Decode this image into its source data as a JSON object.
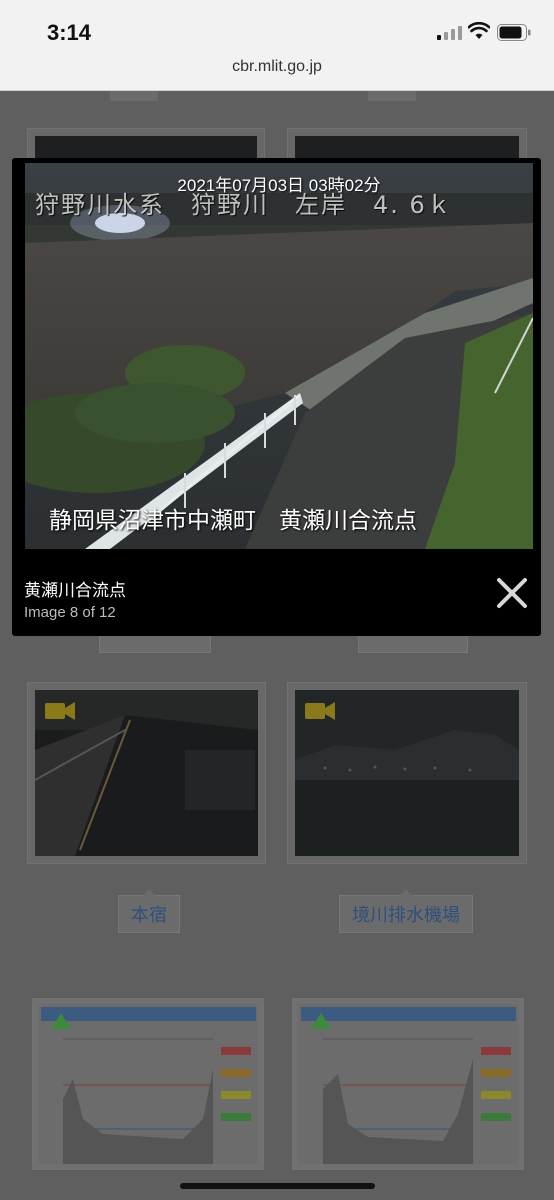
{
  "status_bar": {
    "time": "3:14",
    "url": "cbr.mlit.go.jp"
  },
  "lightbox": {
    "timestamp": "2021年07月03日 03時02分",
    "overlay_top": "狩野川水系　狩野川　左岸　4. 6ｋ",
    "overlay_bottom": "静岡県沼津市中瀬町　黄瀬川合流点",
    "caption": "黄瀬川合流点",
    "counter": "Image 8 of 12"
  },
  "cameras": [
    {
      "label": "本宿"
    },
    {
      "label": "境川排水機場"
    }
  ],
  "icons": {
    "camera": "video-camera-icon",
    "close": "close-icon"
  },
  "colors": {
    "backdrop": "#5f5f5f",
    "label_text": "#2f4f7f",
    "lightbox_bg": "#000000"
  }
}
